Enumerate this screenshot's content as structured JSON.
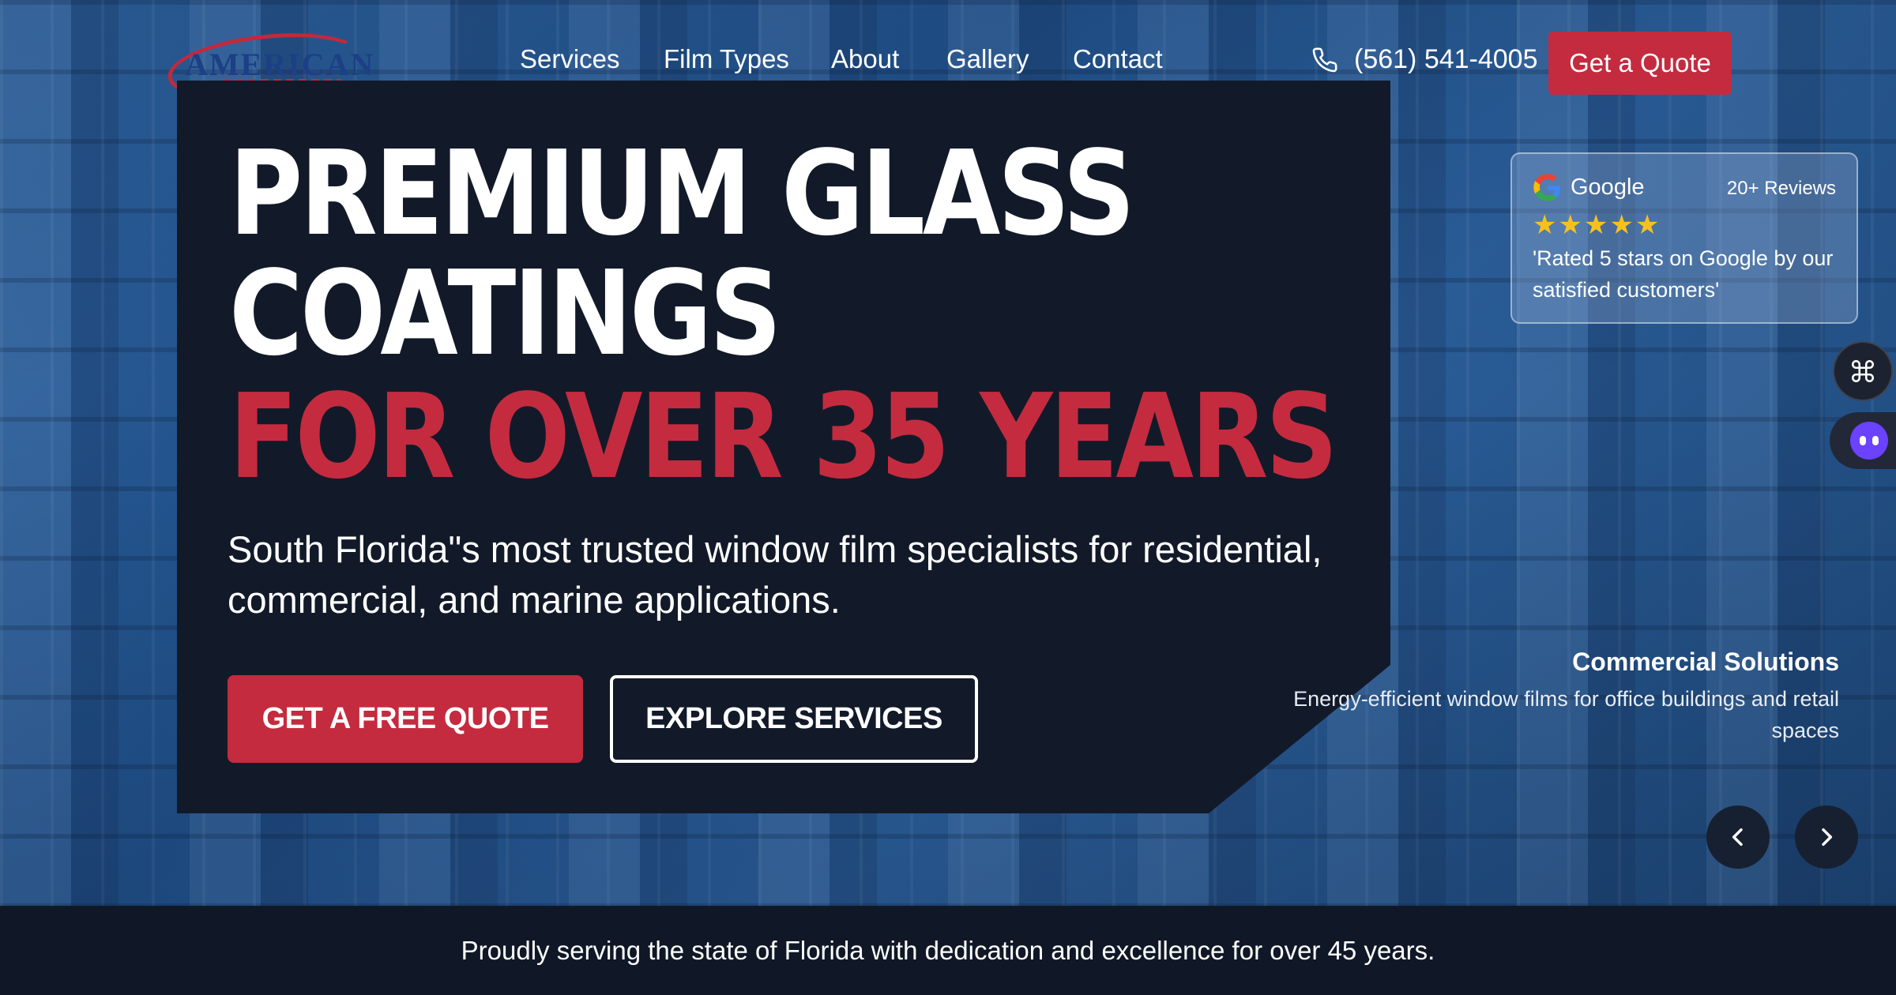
{
  "logo": {
    "text": "AMERICAN"
  },
  "nav": {
    "items": [
      "Services",
      "Film Types",
      "About",
      "Gallery",
      "Contact"
    ],
    "phone": "(561) 541-4005",
    "cta_label": "Get a Quote"
  },
  "hero": {
    "line1": "PREMIUM GLASS",
    "line2": "COATINGS",
    "line3": "FOR OVER 35 YEARS",
    "subtitle": "South Florida\"s most trusted window film specialists for residential, commercial, and marine applications.",
    "primary_button": "GET A FREE QUOTE",
    "secondary_button": "EXPLORE SERVICES"
  },
  "review": {
    "provider": "Google",
    "count": "20+ Reviews",
    "stars": "★★★★★",
    "rating_value": 5,
    "quote": "'Rated 5 stars on Google by our satisfied customers'"
  },
  "slide": {
    "title": "Commercial Solutions",
    "description": "Energy-efficient window films for office buildings and retail spaces"
  },
  "footer_bar": {
    "text": "Proudly serving the state of Florida with dedication and excellence for over 45 years."
  },
  "colors": {
    "accent": "#c42b3f",
    "panel": "#121a29",
    "star": "#f6c11f"
  }
}
